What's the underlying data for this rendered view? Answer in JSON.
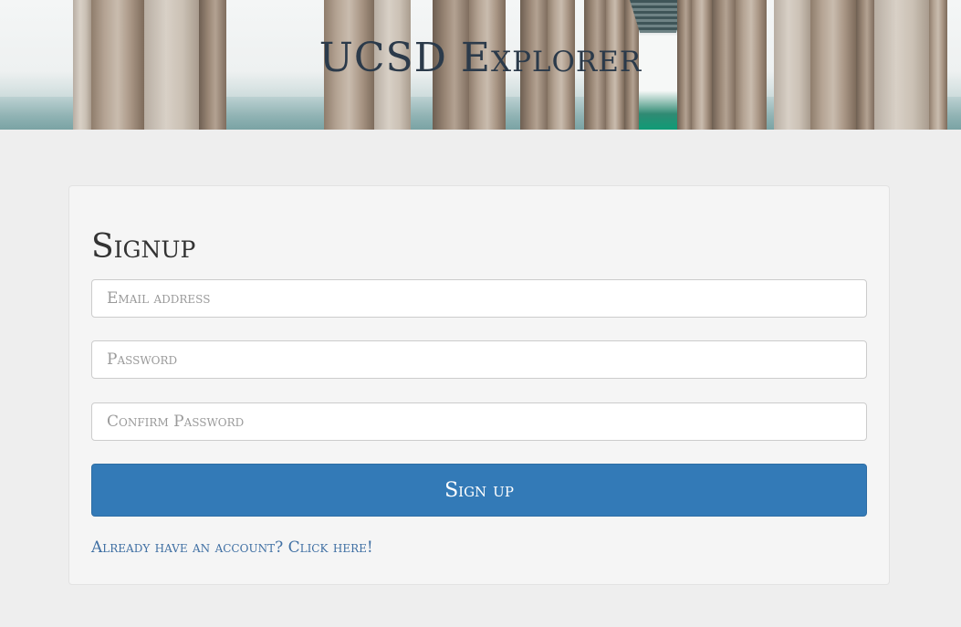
{
  "header": {
    "title": "UCSD Explorer"
  },
  "signup_form": {
    "heading": "Signup",
    "email_placeholder": "Email address",
    "email_value": "",
    "password_placeholder": "Password",
    "password_value": "",
    "confirm_placeholder": "Confirm Password",
    "confirm_value": "",
    "submit_label": "Sign up",
    "login_link_text": "Already have an account? Click here!"
  },
  "colors": {
    "primary_button": "#337ab7",
    "link": "#3f6fa3",
    "page_background": "#eeeeee",
    "card_background": "#f5f5f5"
  }
}
